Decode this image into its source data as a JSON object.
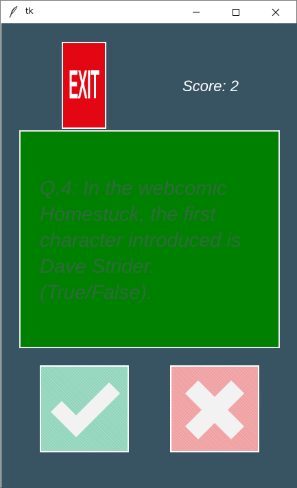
{
  "window": {
    "title": "tk",
    "app_icon": "feather-icon",
    "controls": [
      "minimize-icon",
      "maximize-icon",
      "close-icon"
    ]
  },
  "exit_button": {
    "label": "EXIT",
    "color": "#e30613"
  },
  "score": {
    "text": "Score: 2"
  },
  "question": {
    "text": "Q.4: In the webcomic Homestuck, the first character introduced is Dave Strider. (True/False).",
    "box_color": "#008000"
  },
  "answers": {
    "true_icon": "check-icon",
    "false_icon": "cross-icon",
    "true_color": "#8fd4bb",
    "false_color": "#ef9e9f"
  },
  "colors": {
    "background": "#385463"
  }
}
